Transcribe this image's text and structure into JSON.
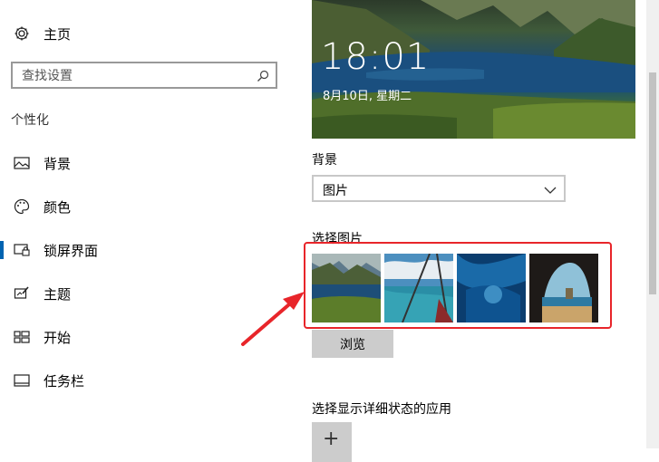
{
  "sidebar": {
    "home_label": "主页",
    "search_placeholder": "查找设置",
    "section_title": "个性化",
    "items": [
      {
        "label": "背景",
        "icon": "picture-icon"
      },
      {
        "label": "颜色",
        "icon": "palette-icon"
      },
      {
        "label": "锁屏界面",
        "icon": "lock-screen-icon",
        "active": true
      },
      {
        "label": "主题",
        "icon": "theme-icon"
      },
      {
        "label": "开始",
        "icon": "start-icon"
      },
      {
        "label": "任务栏",
        "icon": "taskbar-icon"
      }
    ]
  },
  "main": {
    "preview": {
      "time": "18:01",
      "date": "8月10日, 星期二"
    },
    "background_label": "背景",
    "background_value": "图片",
    "choose_picture_label": "选择图片",
    "browse_label": "浏览",
    "detail_app_label": "选择显示详细状态的应用",
    "add_symbol": "+"
  },
  "colors": {
    "accent": "#0063b1",
    "highlight": "#e8252a"
  }
}
